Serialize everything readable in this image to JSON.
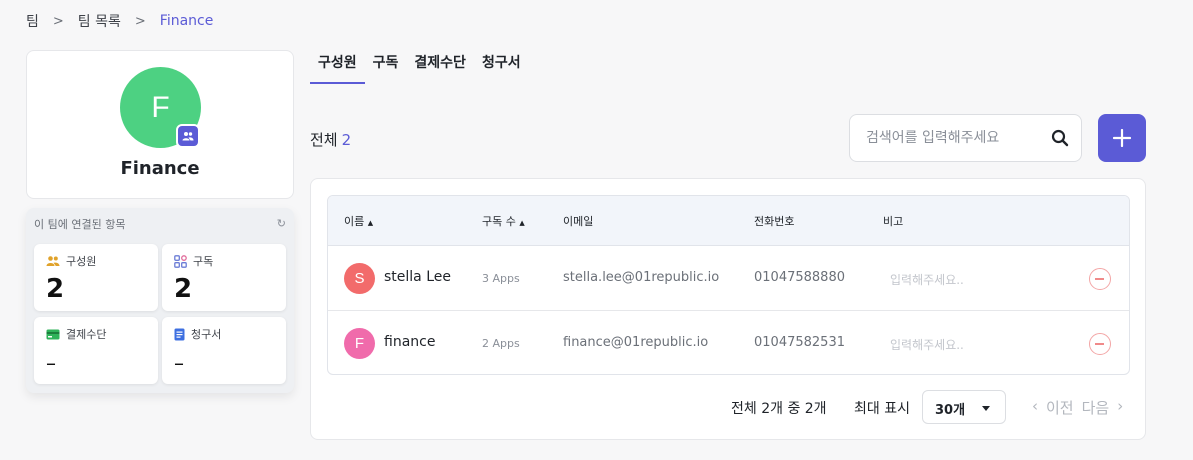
{
  "breadcrumb": [
    "팀",
    "팀 목록",
    "Finance"
  ],
  "team": {
    "name": "Finance",
    "initial": "F"
  },
  "linked": {
    "title": "이 팀에 연결된 항목",
    "members": {
      "label": "구성원",
      "value": "2"
    },
    "subs": {
      "label": "구독",
      "value": "2"
    },
    "payment": {
      "label": "결제수단",
      "value": "–"
    },
    "invoice": {
      "label": "청구서",
      "value": "–"
    }
  },
  "tabs": [
    "구성원",
    "구독",
    "결제수단",
    "청구서"
  ],
  "total_label": "전체",
  "total_count": "2",
  "search": {
    "placeholder": "검색어를 입력해주세요"
  },
  "table": {
    "headers": [
      "이름",
      "구독 수",
      "이메일",
      "전화번호",
      "비고"
    ],
    "rows": [
      {
        "initial": "S",
        "name": "stella Lee",
        "apps": "3 Apps",
        "email": "stella.lee@01republic.io",
        "phone": "01047588880",
        "note_placeholder": "입력해주세요..",
        "avatar_color": "#f26b6b"
      },
      {
        "initial": "F",
        "name": "finance",
        "apps": "2 Apps",
        "email": "finance@01republic.io",
        "phone": "01047582531",
        "note_placeholder": "입력해주세요..",
        "avatar_color": "#f06bab"
      }
    ]
  },
  "footer": {
    "summary": "전체 2개 중 2개",
    "per_page_label": "최대 표시",
    "per_page_value": "30개",
    "prev": "이전",
    "next": "다음"
  },
  "colors": {
    "accent": "#5b5bd6",
    "team_avatar": "#4dd182"
  }
}
